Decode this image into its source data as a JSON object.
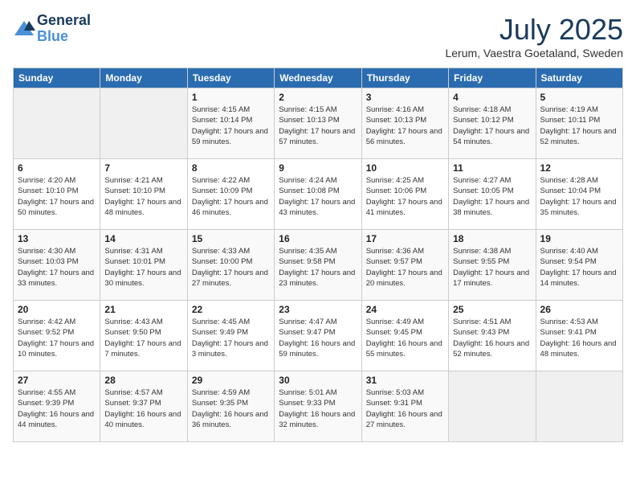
{
  "header": {
    "logo_line1": "General",
    "logo_line2": "Blue",
    "month": "July 2025",
    "location": "Lerum, Vaestra Goetaland, Sweden"
  },
  "days_of_week": [
    "Sunday",
    "Monday",
    "Tuesday",
    "Wednesday",
    "Thursday",
    "Friday",
    "Saturday"
  ],
  "weeks": [
    [
      {
        "day": "",
        "content": ""
      },
      {
        "day": "",
        "content": ""
      },
      {
        "day": "1",
        "content": "Sunrise: 4:15 AM\nSunset: 10:14 PM\nDaylight: 17 hours and 59 minutes."
      },
      {
        "day": "2",
        "content": "Sunrise: 4:15 AM\nSunset: 10:13 PM\nDaylight: 17 hours and 57 minutes."
      },
      {
        "day": "3",
        "content": "Sunrise: 4:16 AM\nSunset: 10:13 PM\nDaylight: 17 hours and 56 minutes."
      },
      {
        "day": "4",
        "content": "Sunrise: 4:18 AM\nSunset: 10:12 PM\nDaylight: 17 hours and 54 minutes."
      },
      {
        "day": "5",
        "content": "Sunrise: 4:19 AM\nSunset: 10:11 PM\nDaylight: 17 hours and 52 minutes."
      }
    ],
    [
      {
        "day": "6",
        "content": "Sunrise: 4:20 AM\nSunset: 10:10 PM\nDaylight: 17 hours and 50 minutes."
      },
      {
        "day": "7",
        "content": "Sunrise: 4:21 AM\nSunset: 10:10 PM\nDaylight: 17 hours and 48 minutes."
      },
      {
        "day": "8",
        "content": "Sunrise: 4:22 AM\nSunset: 10:09 PM\nDaylight: 17 hours and 46 minutes."
      },
      {
        "day": "9",
        "content": "Sunrise: 4:24 AM\nSunset: 10:08 PM\nDaylight: 17 hours and 43 minutes."
      },
      {
        "day": "10",
        "content": "Sunrise: 4:25 AM\nSunset: 10:06 PM\nDaylight: 17 hours and 41 minutes."
      },
      {
        "day": "11",
        "content": "Sunrise: 4:27 AM\nSunset: 10:05 PM\nDaylight: 17 hours and 38 minutes."
      },
      {
        "day": "12",
        "content": "Sunrise: 4:28 AM\nSunset: 10:04 PM\nDaylight: 17 hours and 35 minutes."
      }
    ],
    [
      {
        "day": "13",
        "content": "Sunrise: 4:30 AM\nSunset: 10:03 PM\nDaylight: 17 hours and 33 minutes."
      },
      {
        "day": "14",
        "content": "Sunrise: 4:31 AM\nSunset: 10:01 PM\nDaylight: 17 hours and 30 minutes."
      },
      {
        "day": "15",
        "content": "Sunrise: 4:33 AM\nSunset: 10:00 PM\nDaylight: 17 hours and 27 minutes."
      },
      {
        "day": "16",
        "content": "Sunrise: 4:35 AM\nSunset: 9:58 PM\nDaylight: 17 hours and 23 minutes."
      },
      {
        "day": "17",
        "content": "Sunrise: 4:36 AM\nSunset: 9:57 PM\nDaylight: 17 hours and 20 minutes."
      },
      {
        "day": "18",
        "content": "Sunrise: 4:38 AM\nSunset: 9:55 PM\nDaylight: 17 hours and 17 minutes."
      },
      {
        "day": "19",
        "content": "Sunrise: 4:40 AM\nSunset: 9:54 PM\nDaylight: 17 hours and 14 minutes."
      }
    ],
    [
      {
        "day": "20",
        "content": "Sunrise: 4:42 AM\nSunset: 9:52 PM\nDaylight: 17 hours and 10 minutes."
      },
      {
        "day": "21",
        "content": "Sunrise: 4:43 AM\nSunset: 9:50 PM\nDaylight: 17 hours and 7 minutes."
      },
      {
        "day": "22",
        "content": "Sunrise: 4:45 AM\nSunset: 9:49 PM\nDaylight: 17 hours and 3 minutes."
      },
      {
        "day": "23",
        "content": "Sunrise: 4:47 AM\nSunset: 9:47 PM\nDaylight: 16 hours and 59 minutes."
      },
      {
        "day": "24",
        "content": "Sunrise: 4:49 AM\nSunset: 9:45 PM\nDaylight: 16 hours and 55 minutes."
      },
      {
        "day": "25",
        "content": "Sunrise: 4:51 AM\nSunset: 9:43 PM\nDaylight: 16 hours and 52 minutes."
      },
      {
        "day": "26",
        "content": "Sunrise: 4:53 AM\nSunset: 9:41 PM\nDaylight: 16 hours and 48 minutes."
      }
    ],
    [
      {
        "day": "27",
        "content": "Sunrise: 4:55 AM\nSunset: 9:39 PM\nDaylight: 16 hours and 44 minutes."
      },
      {
        "day": "28",
        "content": "Sunrise: 4:57 AM\nSunset: 9:37 PM\nDaylight: 16 hours and 40 minutes."
      },
      {
        "day": "29",
        "content": "Sunrise: 4:59 AM\nSunset: 9:35 PM\nDaylight: 16 hours and 36 minutes."
      },
      {
        "day": "30",
        "content": "Sunrise: 5:01 AM\nSunset: 9:33 PM\nDaylight: 16 hours and 32 minutes."
      },
      {
        "day": "31",
        "content": "Sunrise: 5:03 AM\nSunset: 9:31 PM\nDaylight: 16 hours and 27 minutes."
      },
      {
        "day": "",
        "content": ""
      },
      {
        "day": "",
        "content": ""
      }
    ]
  ]
}
